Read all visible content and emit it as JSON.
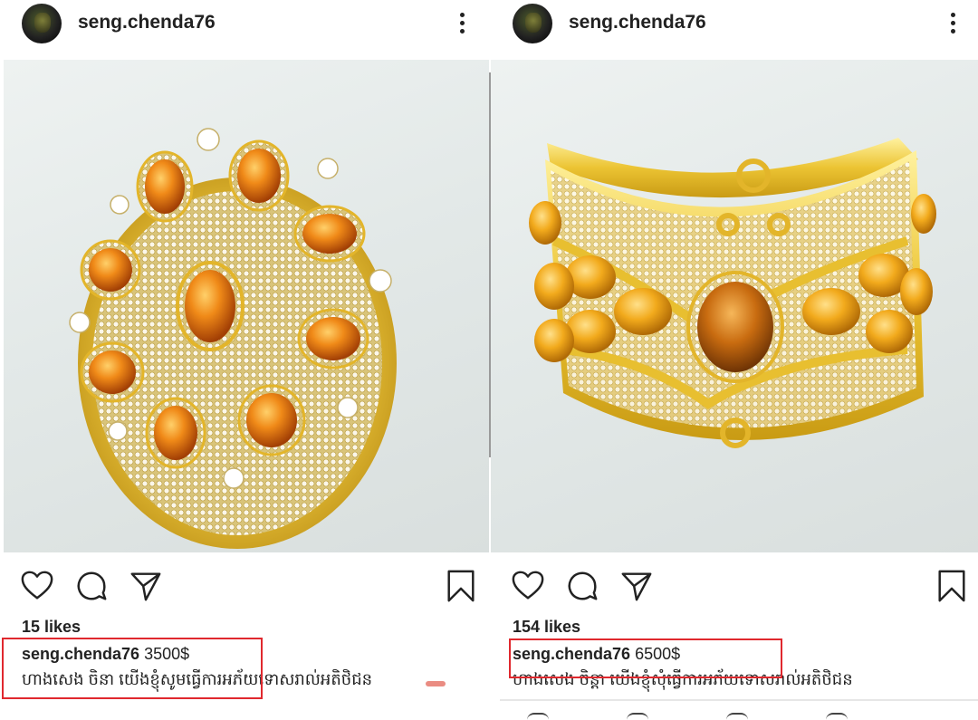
{
  "posts": [
    {
      "username": "seng.chenda76",
      "likes": "15 likes",
      "caption_user": "seng.chenda76",
      "price": "3500$",
      "caption_line2": "ហាងសេង ចិនា យើងខ្ញុំសូមធ្វើការអភ័យទោសរាល់អតិថិជន"
    },
    {
      "username": "seng.chenda76",
      "likes": "154 likes",
      "caption_user": "seng.chenda76",
      "price": "6500$",
      "caption_line2": "ហាងសេង ចិន្តា យើងខ្ញុំសុំធ្វើការអភ័យទោសរាល់អតិថិជន"
    }
  ],
  "icons": [
    "more-vertical-icon",
    "heart-icon",
    "comment-icon",
    "share-icon",
    "bookmark-icon"
  ],
  "colors": {
    "highlight_box": "#e0282e",
    "gold": "#e8b820",
    "stone": "#e07b12"
  }
}
